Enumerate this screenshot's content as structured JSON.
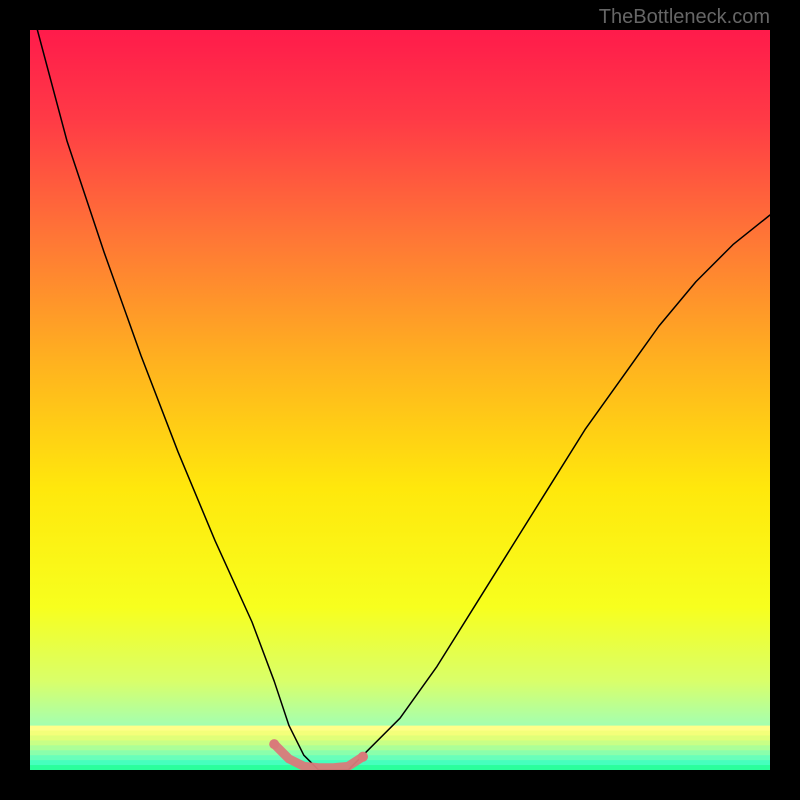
{
  "watermark": "TheBottleneck.com",
  "chart_data": {
    "type": "line",
    "title": "",
    "xlabel": "",
    "ylabel": "",
    "xlim": [
      0,
      100
    ],
    "ylim": [
      0,
      100
    ],
    "grid": false,
    "series": [
      {
        "name": "curve",
        "color": "#000000",
        "stroke_width": 1.5,
        "x": [
          1,
          5,
          10,
          15,
          20,
          25,
          30,
          33,
          35,
          37,
          39,
          41,
          43,
          45,
          50,
          55,
          60,
          65,
          70,
          75,
          80,
          85,
          90,
          95,
          100
        ],
        "y": [
          100,
          85,
          70,
          56,
          43,
          31,
          20,
          12,
          6,
          2,
          0,
          0,
          0,
          2,
          7,
          14,
          22,
          30,
          38,
          46,
          53,
          60,
          66,
          71,
          75
        ]
      },
      {
        "name": "valley-highlight",
        "color": "#d97a7a",
        "stroke_width": 9,
        "x": [
          33,
          35,
          37,
          39,
          41,
          43,
          45
        ],
        "y": [
          3.5,
          1.5,
          0.5,
          0.3,
          0.3,
          0.5,
          1.8
        ]
      }
    ],
    "background_gradient": {
      "type": "vertical",
      "stops": [
        {
          "offset": 0.0,
          "color": "#ff1b4b"
        },
        {
          "offset": 0.12,
          "color": "#ff3a46"
        },
        {
          "offset": 0.28,
          "color": "#ff7636"
        },
        {
          "offset": 0.45,
          "color": "#ffb21f"
        },
        {
          "offset": 0.62,
          "color": "#ffe80c"
        },
        {
          "offset": 0.78,
          "color": "#f7ff1e"
        },
        {
          "offset": 0.88,
          "color": "#d9ff6a"
        },
        {
          "offset": 0.94,
          "color": "#a4ffb0"
        },
        {
          "offset": 1.0,
          "color": "#2bff9c"
        }
      ]
    },
    "bottom_band": {
      "top_y": 6,
      "colors": [
        "#ffff8a",
        "#f4ff7a",
        "#e0ff79",
        "#c8ff86",
        "#abff98",
        "#8bffab",
        "#69ffba",
        "#46ffbd",
        "#2bff9c"
      ]
    }
  }
}
